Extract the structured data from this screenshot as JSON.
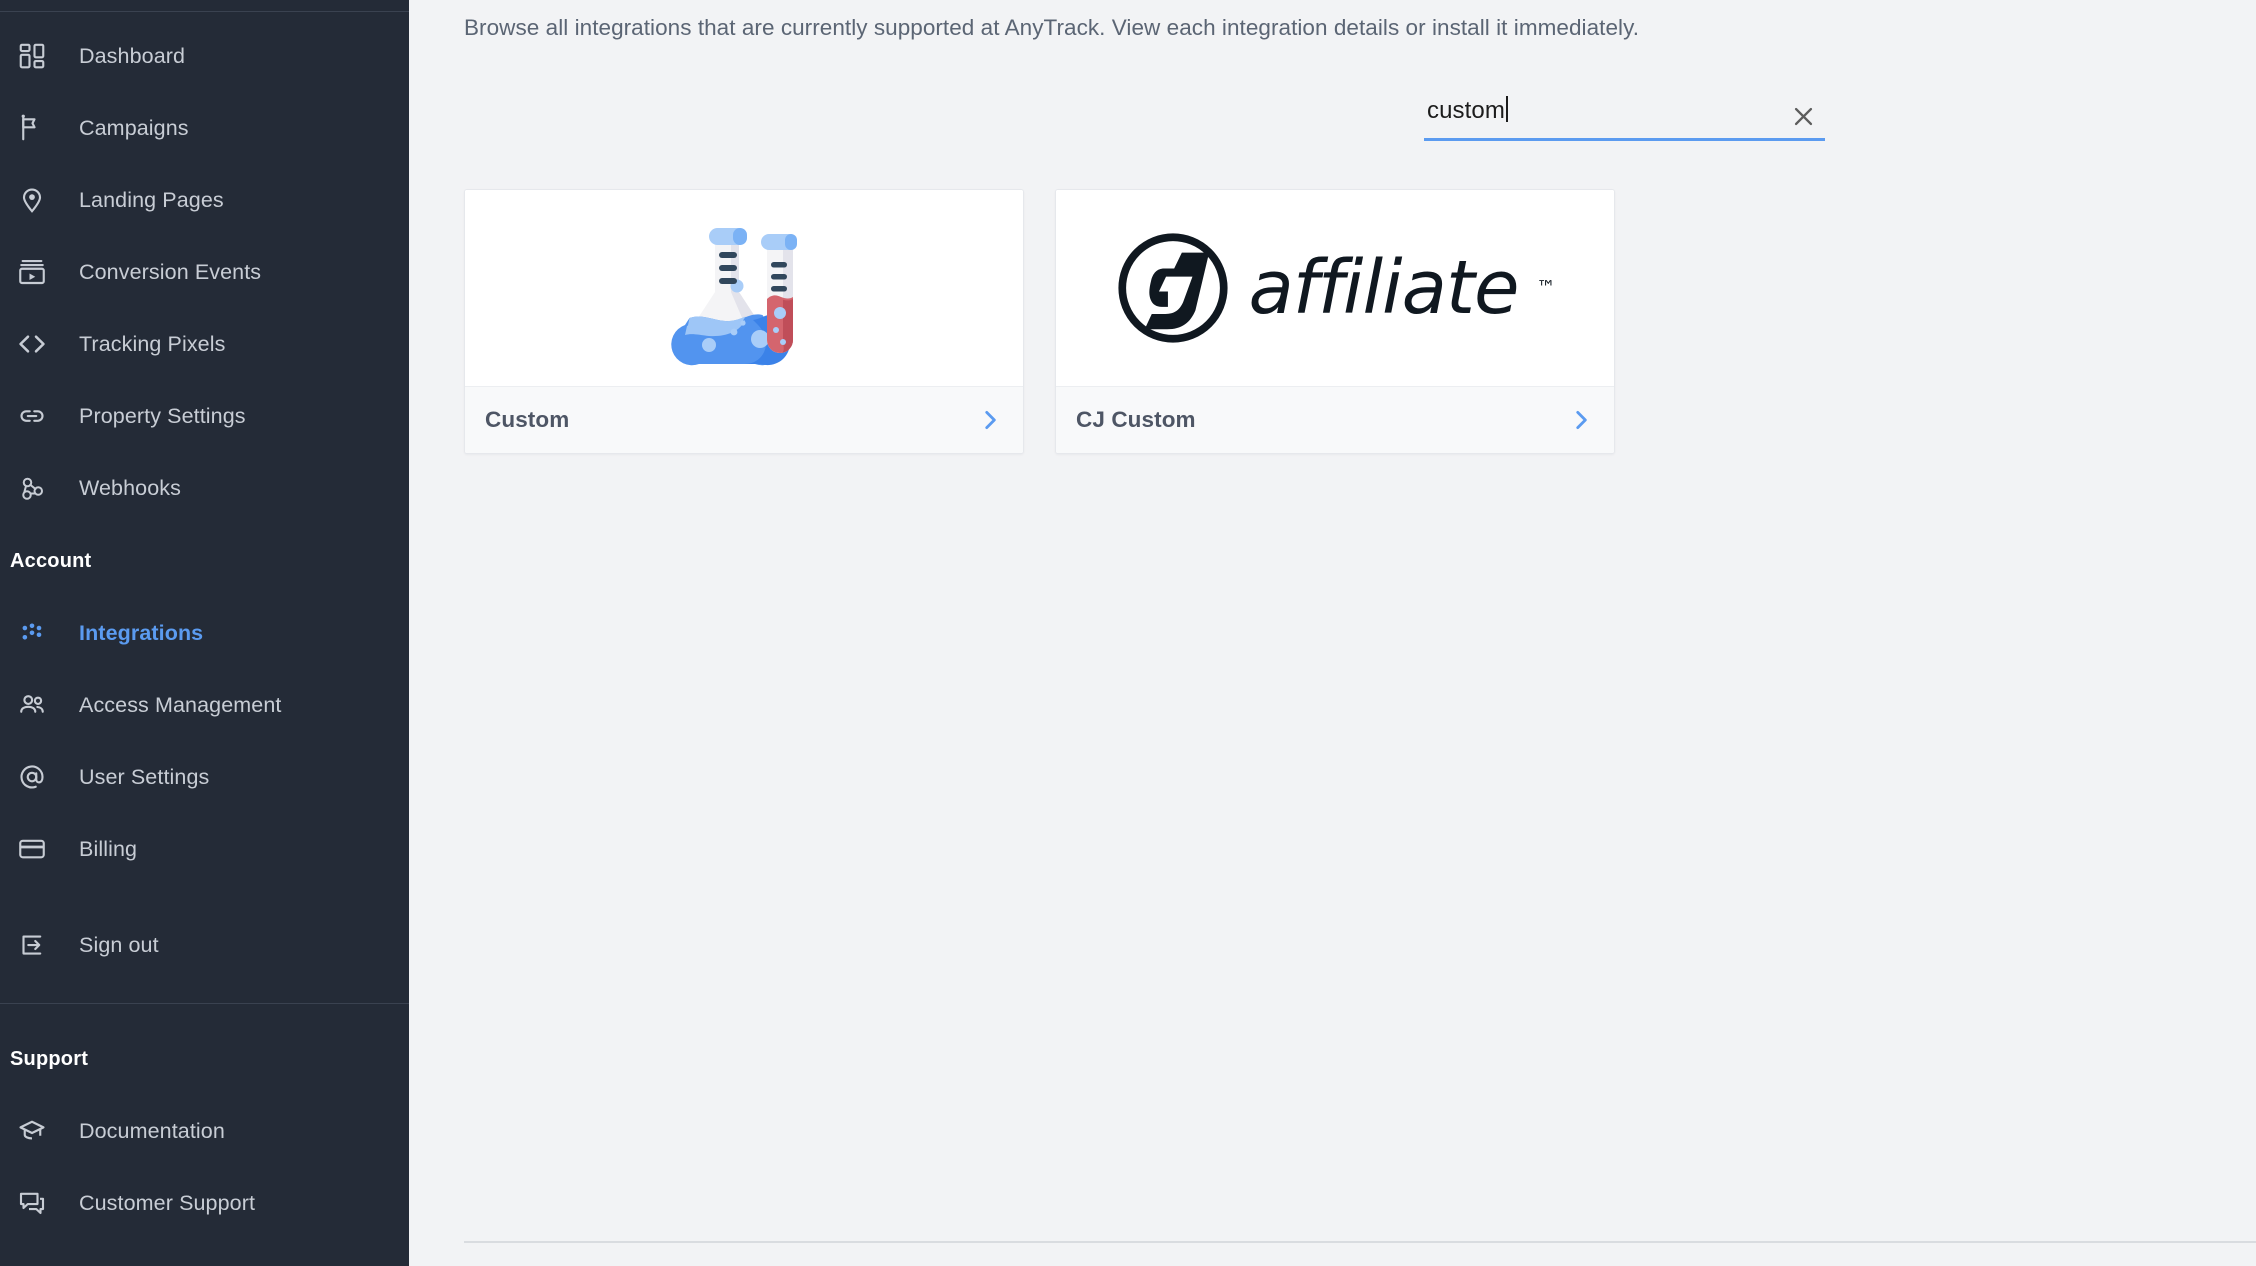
{
  "theme": {
    "sidebar_bg": "#242b37",
    "main_bg": "#f2f3f5",
    "accent": "#5b9bf0",
    "card_bg": "#ffffff",
    "card_footer_bg": "#f8f9fa",
    "nav_text": "#c8cdd5",
    "intro_text": "#5b6574",
    "card_title": "#4e5665"
  },
  "sidebar": {
    "primary_items": [
      {
        "label": "Dashboard",
        "icon": "dashboard-icon",
        "active": false
      },
      {
        "label": "Campaigns",
        "icon": "flag-icon",
        "active": false
      },
      {
        "label": "Landing Pages",
        "icon": "map-pin-icon",
        "active": false
      },
      {
        "label": "Conversion Events",
        "icon": "conversion-events-icon",
        "active": false
      },
      {
        "label": "Tracking Pixels",
        "icon": "code-brackets-icon",
        "active": false
      },
      {
        "label": "Property Settings",
        "icon": "link-icon",
        "active": false
      },
      {
        "label": "Webhooks",
        "icon": "webhook-icon",
        "active": false
      }
    ],
    "account_section": {
      "title": "Account"
    },
    "account_items": [
      {
        "label": "Integrations",
        "icon": "integrations-dots-icon",
        "active": true
      },
      {
        "label": "Access Management",
        "icon": "users-icon",
        "active": false
      },
      {
        "label": "User Settings",
        "icon": "at-sign-icon",
        "active": false
      },
      {
        "label": "Billing",
        "icon": "credit-card-icon",
        "active": false
      }
    ],
    "signout_item": {
      "label": "Sign out",
      "icon": "sign-out-icon"
    },
    "support_section": {
      "title": "Support"
    },
    "support_items": [
      {
        "label": "Documentation",
        "icon": "graduation-cap-icon"
      },
      {
        "label": "Customer Support",
        "icon": "chat-bubbles-icon"
      }
    ]
  },
  "main": {
    "intro": "Browse all integrations that are currently supported at AnyTrack. View each integration details or install it immediately.",
    "search": {
      "value": "custom",
      "placeholder": "",
      "clear_icon": "close-x-icon"
    },
    "cards": [
      {
        "title": "Custom",
        "media": "lab-flask-test-tube-illustration",
        "chevron_icon": "chevron-right-icon"
      },
      {
        "title": "CJ Custom",
        "media": "cj-affiliate-logo",
        "logo_word": "affiliate",
        "logo_tm": "™",
        "chevron_icon": "chevron-right-icon"
      }
    ]
  }
}
